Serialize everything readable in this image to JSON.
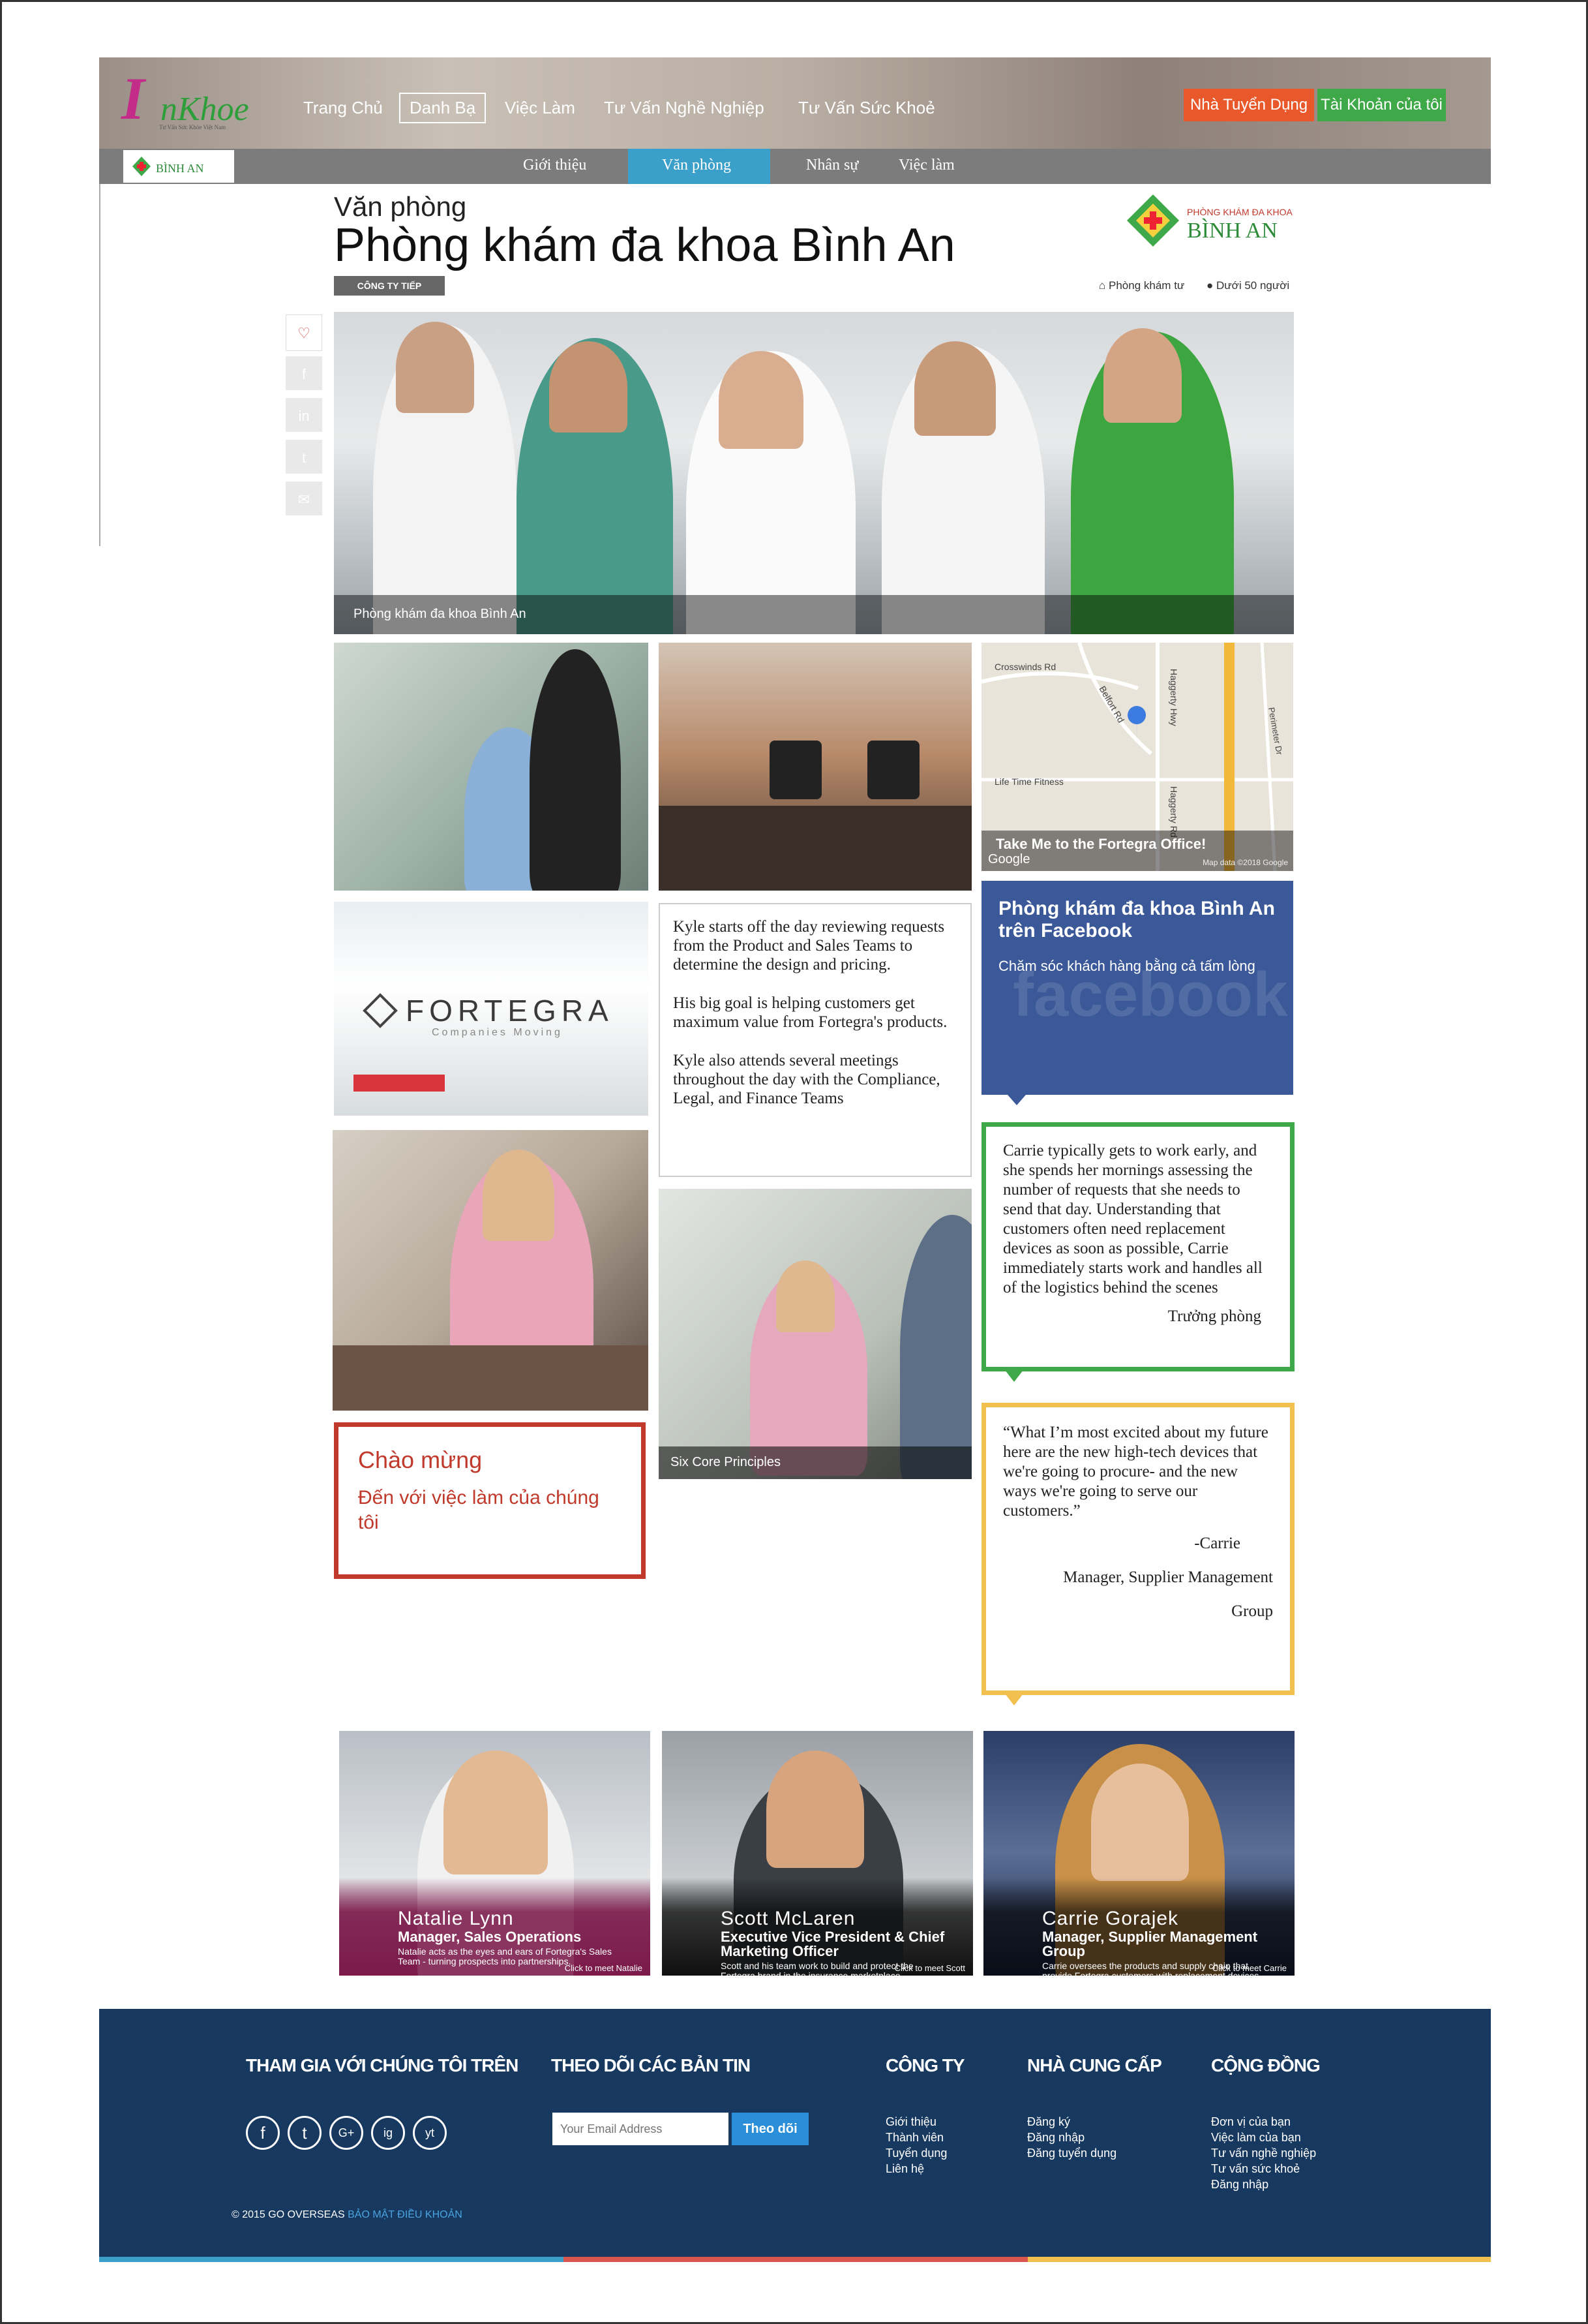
{
  "site": {
    "logo_big": "I",
    "logo_rest": "nKhoe",
    "logo_tagline": "Tư Vấn Sức Khỏe Việt Nam"
  },
  "nav": {
    "items": [
      "Trang Chủ",
      "Danh Bạ",
      "Việc Làm",
      "Tư Vấn Nghề Nghiệp",
      "Tư Vấn Sức Khoẻ"
    ],
    "active": "Danh Bạ",
    "employer_btn": "Nhà Tuyển Dụng",
    "account_btn": "Tài Khoản của tôi"
  },
  "subnav": {
    "logo_name": "BÌNH AN",
    "items": [
      "Giới thiệu",
      "Văn phòng",
      "Nhân sự",
      "Việc làm"
    ],
    "active": "Văn phòng"
  },
  "page": {
    "kicker": "Văn phòng",
    "title": "Phòng khám đa khoa Bình An",
    "badge": "CÔNG TY TIẾP",
    "type": "Phòng khám tư",
    "size": "Dưới 50 người",
    "clinic_logo_top": "PHÒNG KHÁM ĐA KHOA",
    "clinic_logo_name": "BÌNH AN"
  },
  "hero": {
    "caption": "Phòng khám đa khoa Bình An"
  },
  "map": {
    "caption": "Take Me to the Fortegra Office!",
    "labels": [
      "Crosswinds Rd",
      "Belfort Rd",
      "Haggerty Hwy",
      "Life Time Fitness",
      "Haggerty Rd",
      "Perimeter Dr"
    ],
    "brand": "Google",
    "attribution": "Map data ©2018 Google"
  },
  "fortegra": {
    "name": "FORTEGRA",
    "sub": "Companies Moving"
  },
  "kyle": {
    "paragraphs": [
      "Kyle starts off the day reviewing requests from the Product and Sales Teams to determine the design and pricing.",
      "His big goal is helping customers get maximum value from Fortegra's products.",
      "Kyle also attends several meetings throughout the day with the Compliance, Legal, and Finance Teams"
    ]
  },
  "facebook": {
    "title": "Phòng khám đa khoa Bình An trên Facebook",
    "subtitle": "Chăm sóc khách hàng bằng cả tấm lòng",
    "watermark": "facebook"
  },
  "carrie_card": {
    "text": "Carrie typically gets to work early, and she spends her mornings assessing the number of requests that she needs to send that day. Understanding that customers often need replacement devices as soon as possible, Carrie immediately starts work and handles all of the logistics behind the scenes",
    "sign": "Trưởng phòng"
  },
  "welcome": {
    "title": "Chào mừng",
    "subtitle": "Đến với việc làm của chúng tôi"
  },
  "principles": {
    "caption": "Six Core Principles"
  },
  "quote": {
    "text": "“What I’m most excited about my future here are the new high-tech devices that we're going to procure- and the new ways we're going to serve our customers.”",
    "author": "-Carrie",
    "role": "Manager, Supplier Management",
    "role2": "Group"
  },
  "people": [
    {
      "name": "Natalie Lynn",
      "role": "Manager, Sales Operations",
      "desc": "Natalie acts as the eyes and ears of Fortegra's Sales Team - turning prospects into partnerships.",
      "more": "Click to meet Natalie"
    },
    {
      "name": "Scott McLaren",
      "role": "Executive Vice President & Chief Marketing Officer",
      "desc": "Scott and his team work to build and protect the Fortegra brand in the insurance marketplace.",
      "more": "Click to meet Scott"
    },
    {
      "name": "Carrie Gorajek",
      "role": "Manager, Supplier Management Group",
      "desc": "Carrie oversees the products and supply chain that provide Fortegra customers with replacement devices.",
      "more": "Click to meet Carrie"
    }
  ],
  "footer": {
    "join_title": "THAM GIA VỚI CHÚNG TÔI TRÊN",
    "social": [
      "f",
      "t",
      "G+",
      "ig",
      "yt"
    ],
    "newsletter_title": "THEO DÕI CÁC BẢN TIN",
    "email_placeholder": "Your Email Address",
    "subscribe": "Theo dõi",
    "company_title": "CÔNG TY",
    "company_links": [
      "Giới thiệu",
      "Thành viên",
      "Tuyển dụng",
      "Liên hệ"
    ],
    "supplier_title": "NHÀ CUNG CẤP",
    "supplier_links": [
      "Đăng ký",
      "Đăng nhập",
      "Đăng tuyển dụng"
    ],
    "community_title": "CỘNG ĐỒNG",
    "community_links": [
      "Đơn vị của bạn",
      "Việc làm của bạn",
      "Tư vấn nghề nghiệp",
      "Tư vấn sức khoẻ",
      "Đăng nhập"
    ],
    "copyright": "© 2015 GO OVERSEAS",
    "policy": "BẢO MẬT ĐIỀU KHOẢN"
  },
  "colors": {
    "footer": "#17395f",
    "subnav_active": "#3a9fc9",
    "facebook": "#3b5998",
    "green": "#3fa848",
    "orange": "#e8582a",
    "yellow": "#f2c04e",
    "red": "#c0392b"
  }
}
